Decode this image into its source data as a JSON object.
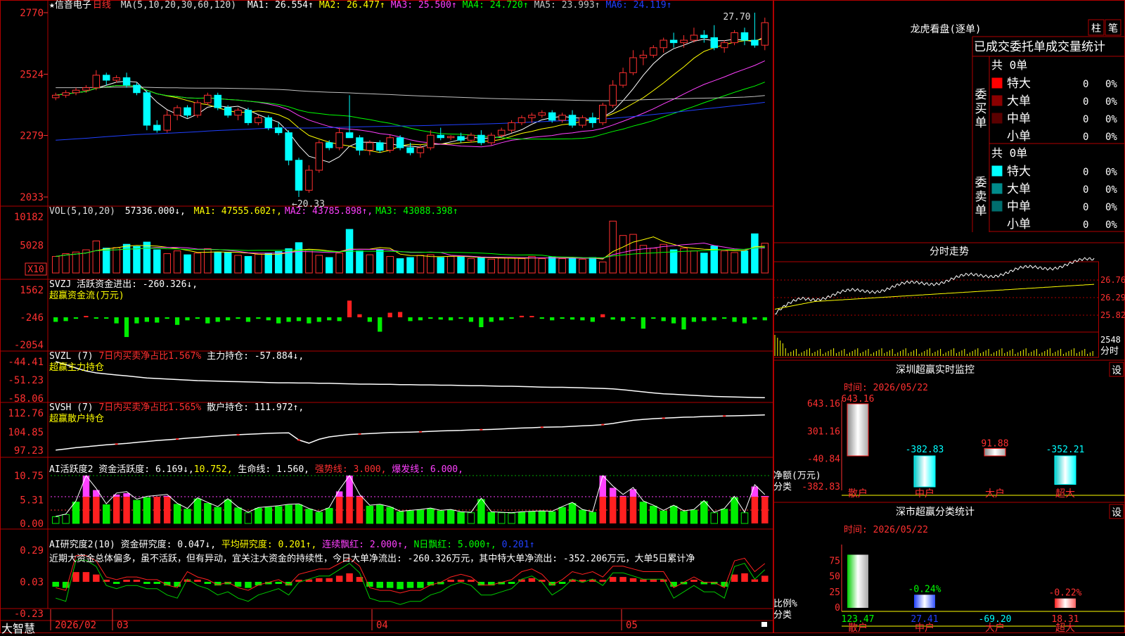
{
  "app": {
    "name": "大智慧"
  },
  "stock": {
    "name": "信音电子",
    "period": "日线"
  },
  "main_panel": {
    "ma_header": "MA(5,10,20,30,60,120)",
    "ma_labels": [
      {
        "label": "MA1: 26.554↑",
        "color": "#ffffff"
      },
      {
        "label": "MA2: 26.477↑",
        "color": "#ffff00"
      },
      {
        "label": "MA3: 25.500↑",
        "color": "#ff40ff"
      },
      {
        "label": "MA4: 24.720↑",
        "color": "#00ff00"
      },
      {
        "label": "MA5: 23.993↑",
        "color": "#c0c0c0"
      },
      {
        "label": "MA6: 24.119↑",
        "color": "#2040ff"
      }
    ],
    "y_ticks": [
      "2770",
      "2524",
      "2279",
      "2033"
    ],
    "high_label": "27.70",
    "low_label": "←20.33"
  },
  "vol_panel": {
    "header": "VOL(5,10,20)",
    "value": "57336.000↓,",
    "ma_labels": [
      {
        "label": "MA1: 47555.602↑,",
        "color": "#ffff00"
      },
      {
        "label": "MA2: 43785.898↑,",
        "color": "#ff40ff"
      },
      {
        "label": "MA3: 43088.398↑",
        "color": "#00ff00"
      }
    ],
    "y_ticks": [
      "10182",
      "5028"
    ],
    "unit": "X10"
  },
  "svzj_panel": {
    "header": "SVZJ  活跃资金进出: -260.326↓,",
    "sub": "超赢资金流(万元)",
    "y_ticks": [
      "1562",
      "-246",
      "-2054"
    ]
  },
  "svzl_panel": {
    "header": "SVZL (7)",
    "ratio": "7日内买卖净占比1.567%",
    "hold": "主力持仓: -57.884↓,",
    "sub": "超赢主力持仓",
    "y_ticks": [
      "-44.41",
      "-51.23",
      "-58.06"
    ]
  },
  "svsh_panel": {
    "header": "SVSH (7)",
    "ratio": "7日内买卖净占比1.565%",
    "hold": "散户持仓: 111.972↑,",
    "sub": "超赢散户持仓",
    "y_ticks": [
      "112.76",
      "104.85",
      "97.23"
    ]
  },
  "ai_active_panel": {
    "header": "AI活跃度2 资金活跃度: 6.169↓,",
    "v2": "10.752,",
    "life": "生命线: 1.560,",
    "strong": "强势线: 3.000,",
    "burst": "爆发线: 6.000,",
    "y_ticks": [
      "10.75",
      "5.31",
      "0.00"
    ]
  },
  "ai_research_panel": {
    "header": "AI研究度2(10) 资金研究度: 0.047↓,",
    "avg": "平均研究度: 0.201↑,",
    "cont": "连续飘红: 2.000↑,",
    "nday": "N日飘红: 5.000↑,",
    "v5": "0.201↑",
    "comment": "近期大资金总体偏多，虽不活跃，但有异动，宜关注大资金的持续性，今日大单净流出: -260.326万元，其中特大单净流出: -352.206万元，大单5日累计净",
    "y_ticks": [
      "0.29",
      "0.03",
      "-0.23"
    ]
  },
  "x_axis": {
    "labels": [
      "2026/02",
      "03",
      "04",
      "05"
    ]
  },
  "right": {
    "longhu": {
      "title": "龙虎看盘(逐单)",
      "btn1": "柱",
      "btn2": "笔",
      "tabs_title": "已成交委托单成交量统计"
    },
    "buy": {
      "side_label": "委买单",
      "total": "共 0单",
      "rows": [
        {
          "label": "特大",
          "color": "#ff0000",
          "val": "0",
          "pct": "0%"
        },
        {
          "label": "大单",
          "color": "#8b0000",
          "val": "0",
          "pct": "0%"
        },
        {
          "label": "中单",
          "color": "#5a0000",
          "val": "0",
          "pct": "0%"
        },
        {
          "label": "小单",
          "color": "#000000",
          "val": "0",
          "pct": "0%"
        }
      ]
    },
    "sell": {
      "side_label": "委卖单",
      "total": "共 0单",
      "rows": [
        {
          "label": "特大",
          "color": "#00ffff",
          "val": "0",
          "pct": "0%"
        },
        {
          "label": "大单",
          "color": "#008b8b",
          "val": "0",
          "pct": "0%"
        },
        {
          "label": "中单",
          "color": "#006e6e",
          "val": "0",
          "pct": "0%"
        },
        {
          "label": "小单",
          "color": "#000000",
          "val": "0",
          "pct": "0%"
        }
      ]
    },
    "intraday": {
      "title": "分时走势",
      "y_ticks": [
        "26.76",
        "26.29",
        "25.82"
      ],
      "vol_tick": "2548",
      "vol_label": "分时"
    },
    "monitor": {
      "title": "深圳超赢实时监控",
      "btn": "设",
      "time": "时间: 2026/05/22",
      "y_ticks": [
        "643.16",
        "301.16",
        "-40.84",
        "-382.83"
      ],
      "ylabel": "净额(万元)",
      "xlabel": "分类",
      "categories": [
        "散户",
        "中户",
        "大户",
        "超大"
      ],
      "values": [
        643.16,
        -382.83,
        91.88,
        -352.21
      ],
      "value_labels": [
        "643.16",
        "-382.83",
        "91.88",
        "-352.21"
      ]
    },
    "classify": {
      "title": "深市超赢分类统计",
      "btn": "设",
      "time": "时间: 2026/05/22",
      "y_ticks": [
        "75",
        "50",
        "25",
        "0"
      ],
      "ylabel": "比例%",
      "xlabel": "分类",
      "categories": [
        "散户",
        "中户",
        "大户",
        "超大"
      ],
      "pct_labels": [
        "",
        "-0.24%",
        "",
        "-0.22%"
      ],
      "values": [
        123.47,
        27.41,
        -69.2,
        18.31
      ],
      "value_labels": [
        "123.47",
        "27.41",
        "-69.20",
        "18.31"
      ]
    }
  },
  "chart_data": {
    "type": "candlestick",
    "title": "信音电子 日线",
    "ylim": [
      20.33,
      27.7
    ],
    "x_ticks": [
      "2026/02",
      "03",
      "04",
      "05"
    ],
    "candles": [
      [
        24.3,
        24.5,
        24.2,
        24.4
      ],
      [
        24.4,
        24.6,
        24.3,
        24.5
      ],
      [
        24.5,
        24.7,
        24.4,
        24.6
      ],
      [
        24.6,
        24.8,
        24.5,
        24.7
      ],
      [
        24.7,
        25.4,
        24.6,
        25.2
      ],
      [
        25.2,
        25.3,
        24.8,
        25.0
      ],
      [
        25.0,
        25.2,
        24.9,
        25.1
      ],
      [
        25.1,
        25.3,
        24.7,
        24.8
      ],
      [
        24.8,
        24.9,
        24.4,
        24.5
      ],
      [
        24.5,
        24.6,
        23.0,
        23.2
      ],
      [
        23.2,
        23.4,
        22.9,
        23.0
      ],
      [
        23.0,
        23.8,
        22.9,
        23.6
      ],
      [
        23.6,
        24.0,
        23.4,
        23.9
      ],
      [
        23.9,
        24.0,
        23.5,
        23.6
      ],
      [
        23.6,
        24.2,
        23.5,
        24.1
      ],
      [
        24.1,
        24.5,
        24.0,
        24.4
      ],
      [
        24.4,
        24.5,
        23.8,
        23.9
      ],
      [
        23.9,
        24.0,
        23.5,
        23.6
      ],
      [
        23.6,
        23.9,
        23.4,
        23.8
      ],
      [
        23.8,
        23.9,
        23.2,
        23.3
      ],
      [
        23.3,
        23.6,
        23.2,
        23.5
      ],
      [
        23.5,
        23.6,
        23.0,
        23.1
      ],
      [
        23.1,
        23.3,
        22.8,
        22.9
      ],
      [
        22.9,
        23.0,
        21.6,
        21.8
      ],
      [
        21.8,
        21.9,
        20.33,
        20.6
      ],
      [
        20.6,
        21.6,
        20.5,
        21.4
      ],
      [
        21.4,
        22.6,
        21.3,
        22.5
      ],
      [
        22.5,
        22.6,
        22.2,
        22.3
      ],
      [
        22.3,
        23.1,
        22.2,
        22.9
      ],
      [
        22.9,
        24.4,
        22.7,
        22.7
      ],
      [
        22.7,
        22.8,
        22.0,
        22.2
      ],
      [
        22.2,
        22.6,
        22.0,
        22.5
      ],
      [
        22.5,
        22.6,
        22.1,
        22.2
      ],
      [
        22.2,
        22.8,
        22.1,
        22.7
      ],
      [
        22.7,
        22.8,
        22.2,
        22.3
      ],
      [
        22.3,
        22.5,
        22.0,
        22.1
      ],
      [
        22.1,
        22.4,
        21.9,
        22.3
      ],
      [
        22.3,
        23.0,
        22.2,
        22.8
      ],
      [
        22.8,
        23.1,
        22.6,
        22.7
      ],
      [
        22.7,
        22.8,
        22.6,
        22.75
      ],
      [
        22.75,
        22.9,
        22.5,
        22.6
      ],
      [
        22.6,
        22.9,
        22.5,
        22.8
      ],
      [
        22.8,
        23.0,
        22.4,
        22.5
      ],
      [
        22.5,
        22.9,
        22.4,
        22.8
      ],
      [
        22.8,
        23.1,
        22.7,
        23.0
      ],
      [
        23.0,
        23.4,
        22.9,
        23.3
      ],
      [
        23.3,
        23.6,
        23.2,
        23.5
      ],
      [
        23.5,
        23.7,
        23.3,
        23.6
      ],
      [
        23.6,
        23.8,
        23.5,
        23.7
      ],
      [
        23.7,
        23.8,
        23.3,
        23.4
      ],
      [
        23.4,
        23.7,
        23.3,
        23.6
      ],
      [
        23.6,
        23.8,
        23.1,
        23.2
      ],
      [
        23.2,
        23.6,
        23.1,
        23.5
      ],
      [
        23.5,
        23.7,
        23.1,
        23.3
      ],
      [
        23.3,
        24.1,
        23.2,
        24.0
      ],
      [
        24.0,
        25.0,
        23.9,
        24.8
      ],
      [
        24.8,
        25.5,
        24.7,
        25.3
      ],
      [
        25.3,
        26.2,
        25.2,
        25.9
      ],
      [
        25.9,
        26.2,
        25.6,
        26.0
      ],
      [
        26.0,
        26.4,
        25.9,
        26.3
      ],
      [
        26.3,
        26.7,
        26.1,
        26.6
      ],
      [
        26.6,
        26.9,
        26.3,
        26.5
      ],
      [
        26.5,
        26.8,
        26.3,
        26.6
      ],
      [
        26.6,
        27.1,
        26.5,
        26.8
      ],
      [
        26.8,
        27.0,
        26.5,
        26.7
      ],
      [
        26.7,
        27.2,
        26.2,
        26.3
      ],
      [
        26.3,
        26.6,
        26.1,
        26.5
      ],
      [
        26.5,
        27.0,
        26.4,
        26.9
      ],
      [
        26.9,
        27.1,
        26.4,
        26.6
      ],
      [
        26.6,
        27.7,
        26.3,
        26.4
      ],
      [
        26.4,
        27.5,
        26.2,
        27.3
      ]
    ],
    "volume": [
      3,
      3.5,
      3.8,
      4.2,
      5.8,
      4.5,
      4.6,
      5.2,
      4.8,
      5.6,
      4.2,
      3.5,
      4.0,
      3.3,
      3.6,
      4.4,
      3.8,
      3.7,
      3.2,
      3.0,
      3.4,
      3.6,
      3.9,
      4.4,
      5.5,
      4.1,
      3.2,
      2.8,
      3.6,
      7.9,
      4.0,
      3.3,
      4.2,
      3.0,
      2.6,
      2.8,
      3.2,
      3.3,
      2.8,
      3.0,
      2.9,
      2.6,
      2.8,
      2.5,
      2.7,
      2.7,
      2.6,
      3.0,
      2.6,
      2.9,
      2.6,
      2.7,
      2.5,
      2.8,
      2.0,
      9.4,
      6.8,
      7.0,
      5.0,
      4.5,
      5.2,
      4.2,
      4.5,
      4.0,
      3.6,
      4.9,
      4.0,
      3.7,
      4.0,
      7.1,
      5.4
    ],
    "svzj": [
      -300,
      -250,
      -100,
      50,
      -50,
      -50,
      -400,
      -1300,
      -400,
      -300,
      -350,
      -100,
      -500,
      -200,
      -100,
      -400,
      -300,
      -200,
      -100,
      -300,
      -100,
      -200,
      -400,
      -300,
      -250,
      -400,
      -300,
      -200,
      -250,
      1100,
      200,
      -300,
      -950,
      300,
      350,
      -250,
      -200,
      -100,
      -150,
      -200,
      -100,
      -300,
      -650,
      -300,
      -200,
      -100,
      100,
      50,
      -100,
      -200,
      -100,
      -150,
      -200,
      -300,
      200,
      -150,
      -250,
      -100,
      -750,
      -100,
      -250,
      -400,
      -800,
      -300,
      -250,
      -200,
      -100,
      -300,
      -400,
      -150,
      -200
    ],
    "svzl": [
      -44.4,
      -45.5,
      -46.8,
      -47.9,
      -48.6,
      -49.0,
      -49.4,
      -49.7,
      -50.1,
      -50.5,
      -50.7,
      -50.9,
      -51.1,
      -51.3,
      -51.5,
      -51.6,
      -51.7,
      -51.8,
      -51.9,
      -52.0,
      -52.1,
      -52.2,
      -52.3,
      -52.3,
      -52.4,
      -52.4,
      -52.5,
      -52.5,
      -52.6,
      -52.7,
      -52.8,
      -52.8,
      -52.9,
      -52.9,
      -53.0,
      -53.0,
      -53.1,
      -53.1,
      -53.2,
      -53.2,
      -53.3,
      -53.4,
      -53.4,
      -53.5,
      -53.6,
      -53.6,
      -53.7,
      -53.8,
      -53.9,
      -54.0,
      -54.0,
      -54.1,
      -54.2,
      -54.3,
      -54.4,
      -54.6,
      -54.9,
      -55.3,
      -55.7,
      -56.1,
      -56.4,
      -56.6,
      -56.8,
      -57.0,
      -57.2,
      -57.4,
      -57.5,
      -57.6,
      -57.7,
      -57.8,
      -57.88
    ],
    "svsh": [
      97.3,
      97.8,
      98.3,
      98.7,
      99.1,
      99.5,
      99.8,
      100.1,
      100.5,
      100.9,
      101.3,
      101.6,
      101.9,
      102.3,
      102.6,
      102.9,
      103.2,
      103.5,
      103.7,
      103.9,
      104.1,
      104.3,
      104.4,
      104.5,
      101.5,
      100.2,
      101.8,
      102.8,
      103.3,
      103.8,
      104.0,
      104.2,
      104.4,
      104.6,
      104.7,
      104.8,
      104.9,
      105.1,
      105.3,
      105.4,
      105.5,
      105.7,
      105.8,
      105.9,
      106.1,
      106.3,
      106.5,
      106.6,
      106.8,
      106.9,
      107.0,
      107.2,
      107.4,
      107.6,
      107.9,
      108.4,
      109.1,
      109.7,
      110.1,
      110.4,
      110.6,
      110.8,
      111.0,
      111.1,
      111.3,
      111.4,
      111.5,
      111.6,
      111.7,
      111.8,
      111.97
    ],
    "ai_active": [
      1.5,
      2.0,
      4.8,
      10.75,
      7.5,
      4.2,
      6.5,
      6.8,
      5.2,
      5.8,
      6.0,
      6.2,
      4.3,
      3.2,
      5.5,
      4.5,
      3.6,
      5.3,
      3.5,
      2.4,
      3.4,
      3.6,
      3.8,
      4.1,
      4.2,
      3.2,
      2.5,
      3.4,
      7.2,
      10.75,
      6.2,
      3.9,
      4.1,
      3.6,
      2.6,
      2.8,
      3.0,
      3.3,
      2.8,
      3.0,
      2.5,
      2.4,
      5.4,
      2.5,
      2.4,
      2.3,
      2.5,
      2.6,
      2.7,
      2.6,
      3.6,
      4.5,
      3.0,
      2.5,
      10.75,
      8.0,
      6.2,
      7.7,
      4.8,
      3.9,
      2.8,
      3.9,
      2.7,
      3.0,
      4.9,
      2.4,
      3.2,
      5.8,
      2.4,
      8.3,
      6.17
    ],
    "ai_research": [
      -0.04,
      -0.05,
      0.08,
      0.08,
      0.06,
      0.0,
      -0.01,
      0.0,
      0.0,
      -0.01,
      -0.01,
      -0.03,
      -0.04,
      0.02,
      0.0,
      -0.01,
      -0.03,
      -0.02,
      -0.04,
      -0.05,
      -0.03,
      -0.02,
      -0.01,
      -0.03,
      0.01,
      0.02,
      0.03,
      0.03,
      0.05,
      0.07,
      0.04,
      -0.04,
      -0.05,
      -0.05,
      -0.06,
      -0.05,
      -0.05,
      -0.03,
      -0.02,
      0.0,
      0.01,
      0.0,
      -0.03,
      -0.03,
      -0.02,
      -0.01,
      0.02,
      0.03,
      0.01,
      -0.03,
      -0.01,
      0.02,
      0.01,
      0.02,
      0.0,
      0.04,
      0.04,
      0.03,
      0.02,
      0.02,
      0.02,
      -0.04,
      -0.02,
      0.0,
      -0.02,
      -0.02,
      -0.04,
      0.06,
      0.07,
      0.02,
      0.05
    ]
  }
}
